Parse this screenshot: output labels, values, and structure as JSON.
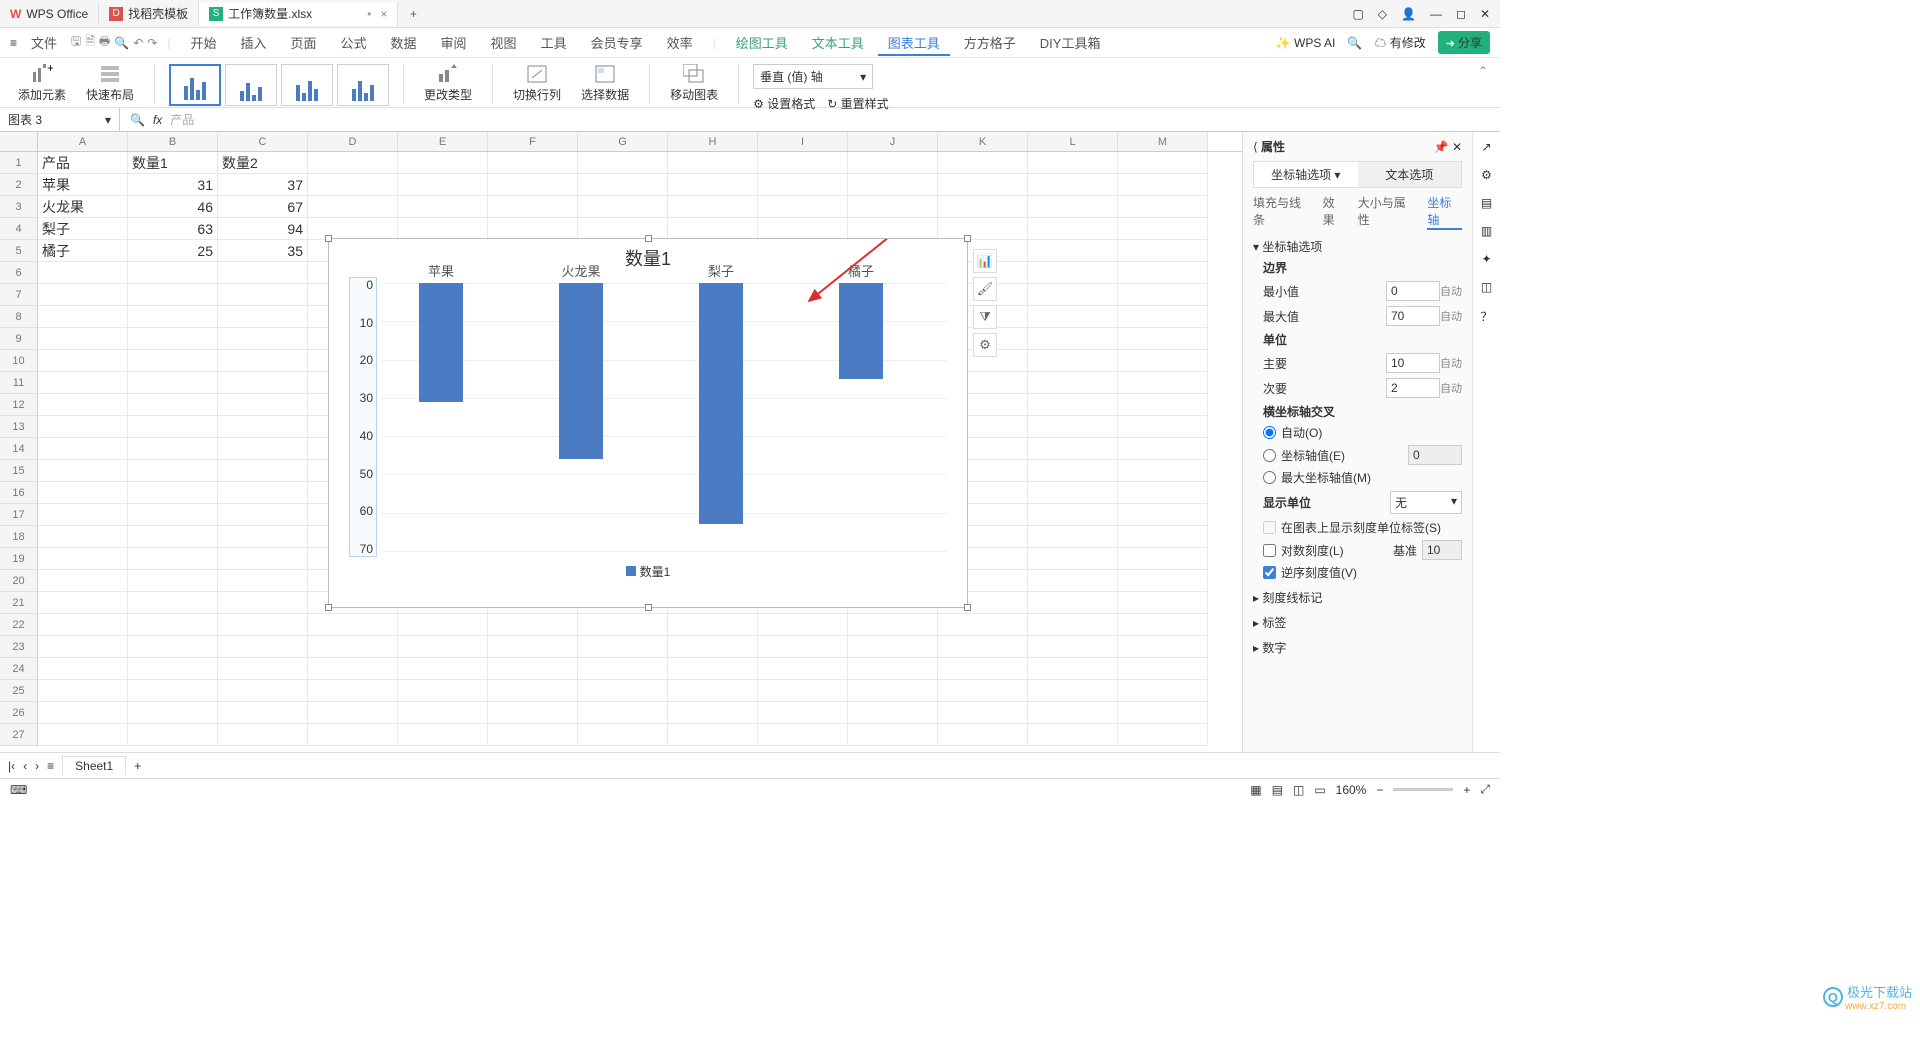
{
  "tabs": {
    "t1": "WPS Office",
    "t2": "找稻壳模板",
    "t3": "工作簿数量.xlsx"
  },
  "win": {
    "modify": "有修改",
    "share": "分享"
  },
  "menu": {
    "file": "文件",
    "items": [
      "开始",
      "插入",
      "页面",
      "公式",
      "数据",
      "审阅",
      "视图",
      "工具",
      "会员专享",
      "效率"
    ],
    "green": [
      "绘图工具",
      "文本工具"
    ],
    "active": "图表工具",
    "more": [
      "方方格子",
      "DIY工具箱"
    ],
    "ai": "WPS AI"
  },
  "ribbon": {
    "addEl": "添加元素",
    "quick": "快速布局",
    "changeType": "更改类型",
    "switchRC": "切换行列",
    "selData": "选择数据",
    "moveChart": "移动图表",
    "axisSelect": "垂直 (值) 轴",
    "setFmt": "设置格式",
    "resetStyle": "重置样式"
  },
  "nameBox": "图表 3",
  "fxVal": "产品",
  "fxSym": "fx",
  "cols": [
    "A",
    "B",
    "C",
    "D",
    "E",
    "F",
    "G",
    "H",
    "I",
    "J",
    "K",
    "L",
    "M"
  ],
  "grid": {
    "r1": [
      "产品",
      "数量1",
      "数量2"
    ],
    "r2": [
      "苹果",
      "31",
      "37"
    ],
    "r3": [
      "火龙果",
      "46",
      "67"
    ],
    "r4": [
      "梨子",
      "63",
      "94"
    ],
    "r5": [
      "橘子",
      "25",
      "35"
    ]
  },
  "chart_data": {
    "type": "bar",
    "title": "数量1",
    "categories": [
      "苹果",
      "火龙果",
      "梨子",
      "橘子"
    ],
    "values": [
      31,
      46,
      63,
      25
    ],
    "ylim": [
      0,
      70
    ],
    "ystep": 10,
    "reversed": true,
    "legend": "数量1"
  },
  "side": {
    "elem": "📊",
    "brush": "🖌",
    "filter": "⧩",
    "gear": "⚙"
  },
  "panel": {
    "title": "属性",
    "tab1": "坐标轴选项",
    "tab2": "文本选项",
    "sub": [
      "填充与线条",
      "效果",
      "大小与属性",
      "坐标轴"
    ],
    "sec1": "坐标轴选项",
    "bound": "边界",
    "min": "最小值",
    "minV": "0",
    "max": "最大值",
    "maxV": "70",
    "auto": "自动",
    "unit": "单位",
    "major": "主要",
    "majorV": "10",
    "minor": "次要",
    "minorV": "2",
    "cross": "横坐标轴交叉",
    "autoO": "自动(O)",
    "axisVal": "坐标轴值(E)",
    "axisValV": "0",
    "maxAxis": "最大坐标轴值(M)",
    "dispUnit": "显示单位",
    "none": "无",
    "showLabel": "在图表上显示刻度单位标签(S)",
    "logScale": "对数刻度(L)",
    "base": "基准",
    "baseV": "10",
    "reverse": "逆序刻度值(V)",
    "s2": "刻度线标记",
    "s3": "标签",
    "s4": "数字"
  },
  "sheet": "Sheet1",
  "zoom": "160%",
  "wm": {
    "name": "极光下载站",
    "url": "www.xz7.com"
  }
}
